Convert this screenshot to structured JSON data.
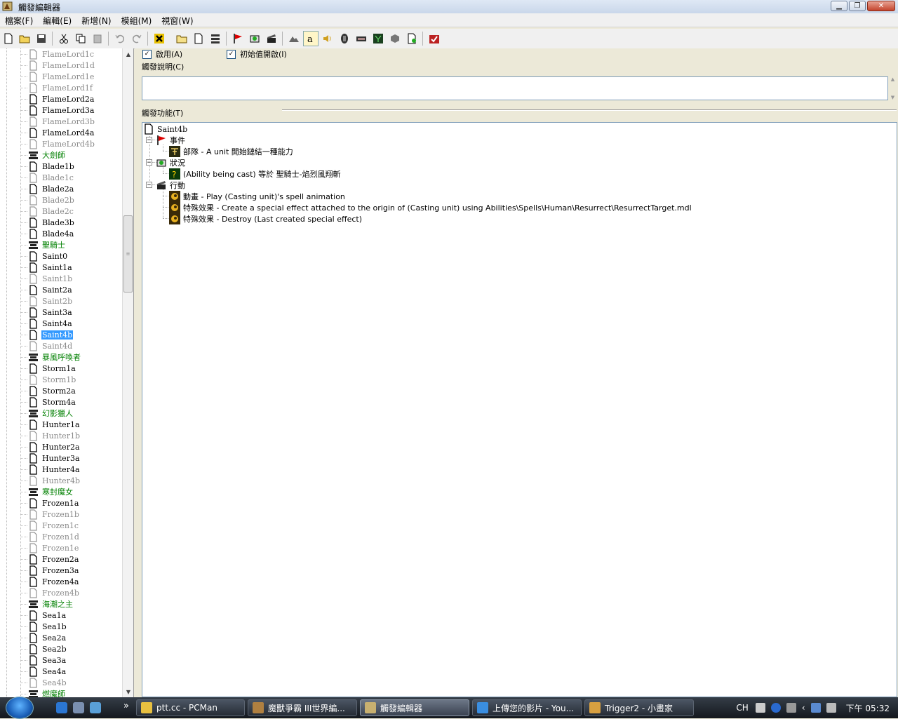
{
  "window": {
    "title": "觸發編輯器"
  },
  "menu": [
    "檔案(F)",
    "編輯(E)",
    "新增(N)",
    "模組(M)",
    "視窗(W)"
  ],
  "left_tree": [
    {
      "label": "FlameLord1c",
      "kind": "disabled"
    },
    {
      "label": "FlameLord1d",
      "kind": "disabled"
    },
    {
      "label": "FlameLord1e",
      "kind": "disabled"
    },
    {
      "label": "FlameLord1f",
      "kind": "disabled"
    },
    {
      "label": "FlameLord2a",
      "kind": "trigger"
    },
    {
      "label": "FlameLord3a",
      "kind": "trigger"
    },
    {
      "label": "FlameLord3b",
      "kind": "disabled"
    },
    {
      "label": "FlameLord4a",
      "kind": "trigger"
    },
    {
      "label": "FlameLord4b",
      "kind": "disabled"
    },
    {
      "label": "大劍師",
      "kind": "category"
    },
    {
      "label": "Blade1b",
      "kind": "trigger"
    },
    {
      "label": "Blade1c",
      "kind": "disabled"
    },
    {
      "label": "Blade2a",
      "kind": "trigger"
    },
    {
      "label": "Blade2b",
      "kind": "disabled"
    },
    {
      "label": "Blade2c",
      "kind": "disabled"
    },
    {
      "label": "Blade3b",
      "kind": "trigger"
    },
    {
      "label": "Blade4a",
      "kind": "trigger"
    },
    {
      "label": "聖騎士",
      "kind": "category"
    },
    {
      "label": "Saint0",
      "kind": "trigger"
    },
    {
      "label": "Saint1a",
      "kind": "trigger"
    },
    {
      "label": "Saint1b",
      "kind": "disabled"
    },
    {
      "label": "Saint2a",
      "kind": "trigger"
    },
    {
      "label": "Saint2b",
      "kind": "disabled"
    },
    {
      "label": "Saint3a",
      "kind": "trigger"
    },
    {
      "label": "Saint4a",
      "kind": "trigger"
    },
    {
      "label": "Saint4b",
      "kind": "selected"
    },
    {
      "label": "Saint4d",
      "kind": "disabled"
    },
    {
      "label": "暴風呼喚者",
      "kind": "category"
    },
    {
      "label": "Storm1a",
      "kind": "trigger"
    },
    {
      "label": "Storm1b",
      "kind": "disabled"
    },
    {
      "label": "Storm2a",
      "kind": "trigger"
    },
    {
      "label": "Storm4a",
      "kind": "trigger"
    },
    {
      "label": "幻影獵人",
      "kind": "category"
    },
    {
      "label": "Hunter1a",
      "kind": "trigger"
    },
    {
      "label": "Hunter1b",
      "kind": "disabled"
    },
    {
      "label": "Hunter2a",
      "kind": "trigger"
    },
    {
      "label": "Hunter3a",
      "kind": "trigger"
    },
    {
      "label": "Hunter4a",
      "kind": "trigger"
    },
    {
      "label": "Hunter4b",
      "kind": "disabled"
    },
    {
      "label": "寒封魔女",
      "kind": "category"
    },
    {
      "label": "Frozen1a",
      "kind": "trigger"
    },
    {
      "label": "Frozen1b",
      "kind": "disabled"
    },
    {
      "label": "Frozen1c",
      "kind": "disabled"
    },
    {
      "label": "Frozen1d",
      "kind": "disabled"
    },
    {
      "label": "Frozen1e",
      "kind": "disabled"
    },
    {
      "label": "Frozen2a",
      "kind": "trigger"
    },
    {
      "label": "Frozen3a",
      "kind": "trigger"
    },
    {
      "label": "Frozen4a",
      "kind": "trigger"
    },
    {
      "label": "Frozen4b",
      "kind": "disabled"
    },
    {
      "label": "海潮之主",
      "kind": "category"
    },
    {
      "label": "Sea1a",
      "kind": "trigger"
    },
    {
      "label": "Sea1b",
      "kind": "trigger"
    },
    {
      "label": "Sea2a",
      "kind": "trigger"
    },
    {
      "label": "Sea2b",
      "kind": "trigger"
    },
    {
      "label": "Sea3a",
      "kind": "trigger"
    },
    {
      "label": "Sea4a",
      "kind": "trigger"
    },
    {
      "label": "Sea4b",
      "kind": "disabled"
    },
    {
      "label": "燃魔師",
      "kind": "category"
    }
  ],
  "editor": {
    "enabled_label": "啟用(A)",
    "initially_on_label": "初始值開啟(I)",
    "comment_label": "觸發說明(C)",
    "comment_value": "",
    "functions_label": "觸發功能(T)",
    "trigger_name": "Saint4b",
    "events_label": "事件",
    "conditions_label": "狀況",
    "actions_label": "行動",
    "event_1": "部隊 - A unit 開始鏈結一種能力",
    "condition_1": "(Ability being cast) 等於 聖騎士-焰烈風翔斬",
    "action_1": "動畫 - Play (Casting unit)'s spell animation",
    "action_2": "特殊效果 - Create a special effect attached to the origin of (Casting unit) using Abilities\\Spells\\Human\\Resurrect\\ResurrectTarget.mdl",
    "action_3": "特殊效果 - Destroy (Last created special effect)"
  },
  "taskbar": {
    "tasks": [
      "ptt.cc - PCMan",
      "魔獸爭霸 III世界編...",
      "觸發編輯器",
      "上傳您的影片 - You...",
      "Trigger2 - 小畫家"
    ],
    "lang": "CH",
    "time": "下午 05:32",
    "more": "»"
  },
  "colors": {
    "category_text": "#008000",
    "disabled_text": "#8a8a8a",
    "selection": "#3399ff"
  }
}
